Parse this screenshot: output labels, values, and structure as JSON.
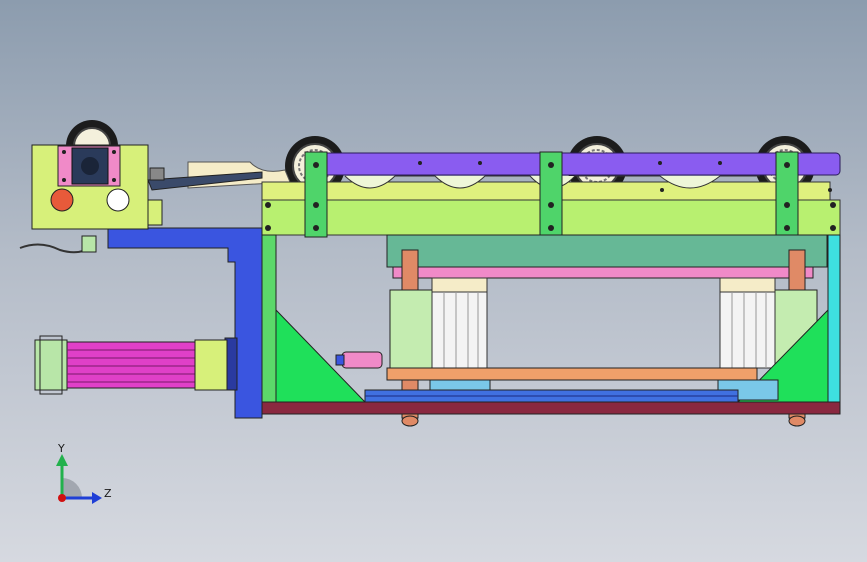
{
  "triad": {
    "y_label": "Y",
    "z_label": "Z",
    "colors": {
      "y_axis": "#22b14c",
      "z_axis": "#1f3fd6",
      "origin": "#d01010"
    }
  },
  "palette": {
    "lime": "#d7f07a",
    "green_frame": "#4fd46a",
    "bright_green": "#1fe05a",
    "purple_rail": "#8a5cf0",
    "blue_motor_frame": "#3a55e0",
    "teal_plate": "#66b896",
    "pink_plate": "#f08ac8",
    "orange_plate": "#f0a06a",
    "maroon_base": "#8a2840",
    "cyan": "#3ee0e0",
    "magenta_motor": "#e040c8",
    "copper": "#e08a66",
    "light_green": "#b8e6a8"
  },
  "icons": [
    "conveyor-roller-icon",
    "control-box-icon",
    "red-button-icon",
    "white-button-icon",
    "motor-icon",
    "cylinder-icon",
    "coordinate-triad-icon"
  ]
}
